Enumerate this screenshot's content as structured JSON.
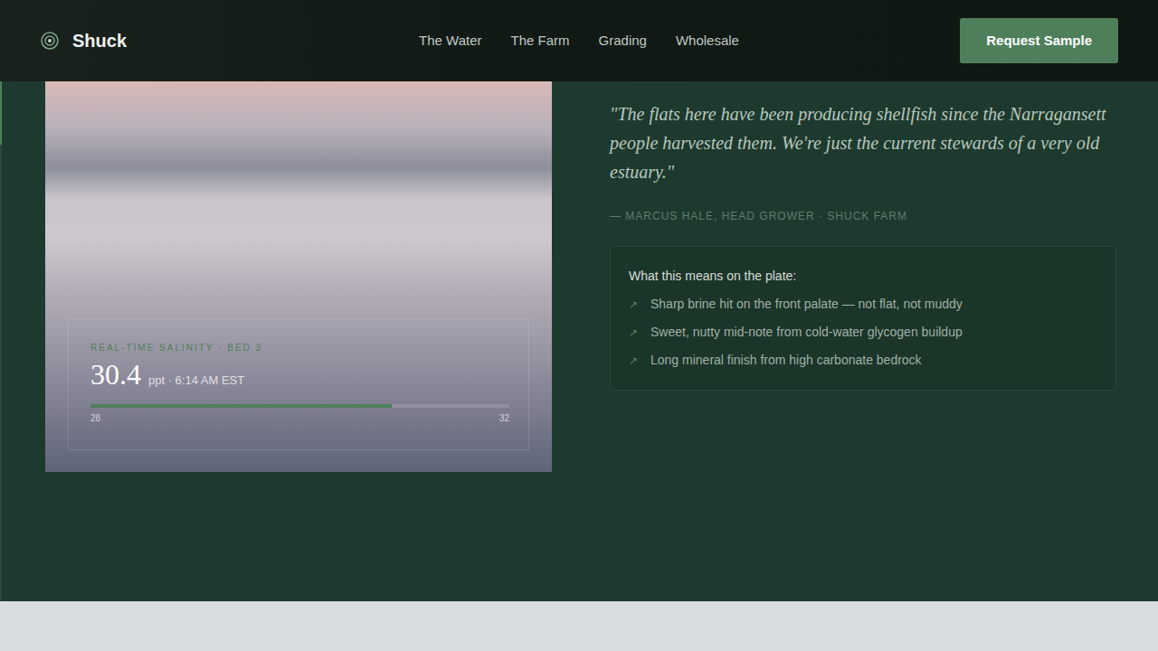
{
  "header": {
    "logo": "Shuck",
    "nav": [
      {
        "label": "The Water",
        "selected": false
      },
      {
        "label": "The Farm",
        "selected": false
      },
      {
        "label": "Grading",
        "selected": false
      },
      {
        "label": "Wholesale",
        "selected": false
      }
    ],
    "cta": "Request Sample"
  },
  "salinity": {
    "label": "REAL-TIME SALINITY · BED 3",
    "value": "30.4",
    "unit": "ppt · 6:14 AM EST",
    "level": 0.72,
    "min": "28",
    "max": "32"
  },
  "quote": {
    "text": "\"The flats here have been producing shellfish since the Narragansett people harvested them. We're just the current stewards of a very old estuary.\"",
    "attribution": "— MARCUS HALE, HEAD GROWER · SHUCK FARM"
  },
  "plate": {
    "title": "What this means on the plate:",
    "items": [
      {
        "icon": "↗",
        "text": "Sharp brine hit on the front palate — not flat, not muddy"
      },
      {
        "icon": "↗",
        "text": "Sweet, nutty mid-note from cold-water glycogen buildup"
      },
      {
        "icon": "↗",
        "text": "Long mineral finish from high carbonate bedrock"
      }
    ]
  }
}
